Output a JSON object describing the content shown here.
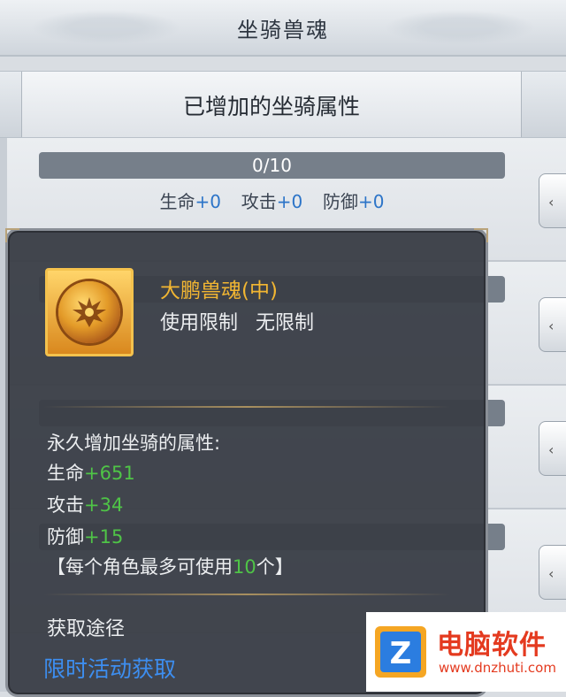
{
  "window": {
    "title": "坐骑兽魂"
  },
  "tabs": {
    "active_label": "已增加的坐骑属性"
  },
  "rows": [
    {
      "progress": "0/10",
      "progress_fraction": 0.0,
      "stats": [
        {
          "label": "生命",
          "value": "+0"
        },
        {
          "label": "攻击",
          "value": "+0"
        },
        {
          "label": "防御",
          "value": "+0"
        }
      ]
    },
    {
      "progress": "",
      "progress_fraction": 0.0,
      "stats": []
    },
    {
      "progress": "",
      "progress_fraction": 0.0,
      "stats": []
    },
    {
      "progress": "",
      "progress_fraction": 0.0,
      "stats": []
    }
  ],
  "tooltip": {
    "item_name": "大鹏兽魂(中)",
    "usage_label": "使用限制",
    "usage_value": "无限制",
    "attr_title": "永久增加坐骑的属性:",
    "attrs": [
      {
        "label": "生命",
        "value": "+651"
      },
      {
        "label": "攻击",
        "value": "+34"
      },
      {
        "label": "防御",
        "value": "+15"
      }
    ],
    "limit_prefix": "【每个角色最多可使用",
    "limit_number": "10",
    "limit_suffix": "个】",
    "source_title": "获取途径",
    "source_link": "限时活动获取",
    "icon": "phoenix-emblem-icon"
  },
  "watermark": {
    "brand": "电脑软件",
    "url": "www.dnzhuti.com",
    "logo_letter": "Z"
  },
  "colors": {
    "gold": "#f2b632",
    "green": "#4fc447",
    "blue": "#3d8ef0",
    "stat_blue": "#2c74c8"
  }
}
